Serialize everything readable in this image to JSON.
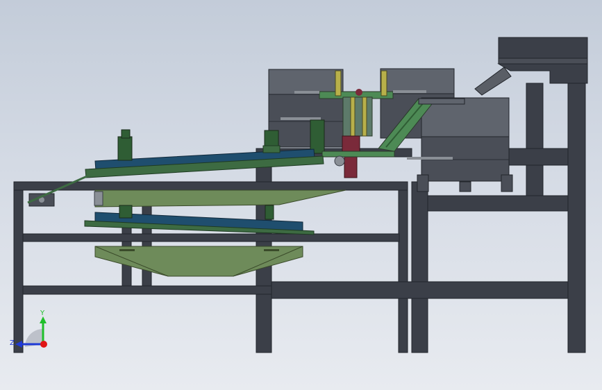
{
  "viewport": {
    "background_top": "#c3ccd9",
    "background_bottom": "#e8ebf0"
  },
  "colors": {
    "frame": "#3b3f48",
    "frame_shadow": "#2a2d34",
    "bowl_gray": "#4a4e57",
    "bowl_top": "#5f646d",
    "conveyor_blue": "#1f4e6e",
    "rail_green": "#3d6b42",
    "hopper_olive": "#6e8b5a",
    "motor_green": "#2f5d34",
    "plate_green": "#4d8a55",
    "accent_maroon": "#7a2a3a",
    "rod_gray": "#8a8f96",
    "arm_yellow": "#b8b04a"
  },
  "triad": {
    "y_label": "Y",
    "z_label": "Z",
    "y_color": "#1fbf2a",
    "z_color": "#1f3ad6",
    "x_color": "#e01515"
  }
}
